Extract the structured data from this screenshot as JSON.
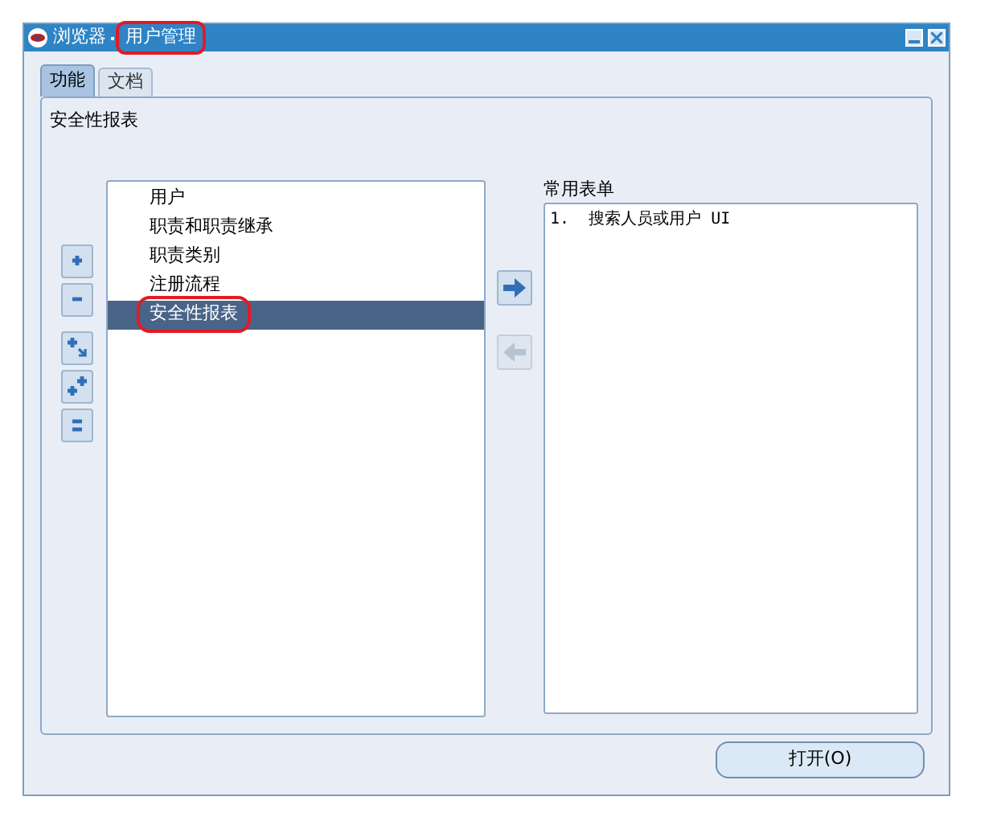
{
  "window": {
    "title": "浏览器",
    "subtitle": "用户管理",
    "subtitle_circled": true
  },
  "tabs": [
    {
      "label": "功能",
      "selected": true
    },
    {
      "label": "文档",
      "selected": false
    }
  ],
  "heading": "安全性报表",
  "tree_buttons": [
    {
      "kind": "expand"
    },
    {
      "kind": "collapse"
    },
    {
      "kind": "expand-branch"
    },
    {
      "kind": "expand-all"
    },
    {
      "kind": "collapse-all"
    }
  ],
  "tree": [
    {
      "label": "用户",
      "selected": false,
      "circled": false
    },
    {
      "label": "职责和职责继承",
      "selected": false,
      "circled": false
    },
    {
      "label": "职责类别",
      "selected": false,
      "circled": false
    },
    {
      "label": "注册流程",
      "selected": false,
      "circled": false
    },
    {
      "label": "安全性报表",
      "selected": true,
      "circled": true
    }
  ],
  "move_buttons": [
    {
      "kind": "add",
      "disabled": false
    },
    {
      "kind": "remove",
      "disabled": true
    }
  ],
  "favorites": {
    "label": "常用表单",
    "items": [
      "1.  搜索人员或用户 UI"
    ]
  },
  "open_button": "打开(O)"
}
